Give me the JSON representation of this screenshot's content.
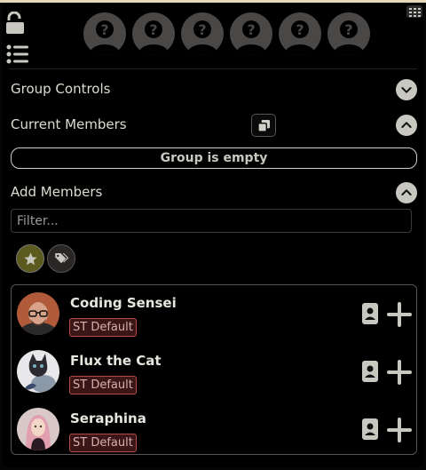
{
  "header": {
    "lock_icon": "lock-open-icon",
    "list_icon": "list-icon",
    "grid_icon": "grid-icon",
    "avatar_slots": 6
  },
  "group_controls": {
    "label": "Group Controls",
    "icon": "chevron-down-icon"
  },
  "current_members": {
    "label": "Current Members",
    "copy_icon": "copy-icon",
    "toggle_icon": "chevron-up-icon",
    "empty_text": "Group is empty"
  },
  "add_members": {
    "label": "Add Members",
    "toggle_icon": "chevron-up-icon",
    "filter_placeholder": "Filter...",
    "filter_value": "",
    "filter_buttons": [
      "star-icon",
      "tags-icon"
    ],
    "characters": [
      {
        "name": "Coding Sensei",
        "tag": "ST Default"
      },
      {
        "name": "Flux the Cat",
        "tag": "ST Default"
      },
      {
        "name": "Seraphina",
        "tag": "ST Default"
      }
    ]
  },
  "colors": {
    "accent": "#c8c8c0",
    "tag_border": "#b44a4a",
    "star_bg": "#5c5a1e"
  }
}
